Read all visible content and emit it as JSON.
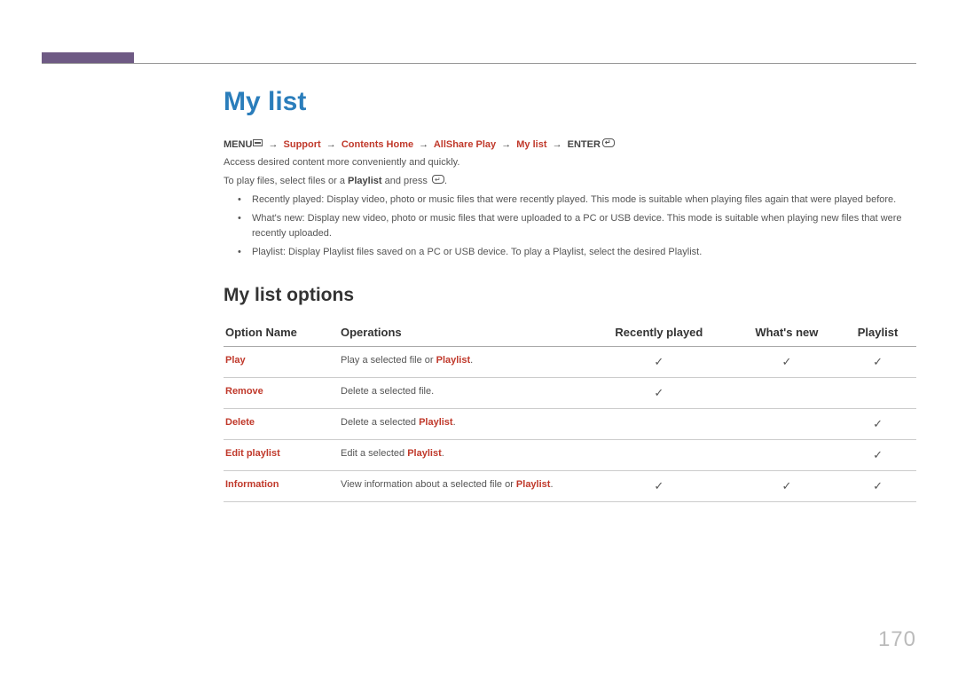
{
  "title": "My list",
  "breadcrumb": {
    "menu": "MENU",
    "parts": [
      "Support",
      "Contents Home",
      "AllShare Play",
      "My list"
    ],
    "enter": "ENTER"
  },
  "intro1": "Access desired content more conveniently and quickly.",
  "intro2_pre": "To play files, select files or a ",
  "intro2_bold": "Playlist",
  "intro2_post": " and press ",
  "bullets": [
    {
      "label": "Recently played",
      "text": ": Display video, photo or music files that were recently played. This mode is suitable when playing files again that were played before."
    },
    {
      "label": "What's new",
      "text": ": Display new video, photo or music files that were uploaded to a PC or USB device. This mode is suitable when playing new files that were recently uploaded."
    },
    {
      "label": "Playlist",
      "text_pre": ": Display ",
      "text_mid1": "Playlist",
      "text_mid2": " files saved on a PC or USB device. To play a ",
      "text_mid3": "Playlist",
      "text_mid4": ", select the desired ",
      "text_end": "Playlist",
      "period": "."
    }
  ],
  "subhead": "My list options",
  "table": {
    "headers": [
      "Option Name",
      "Operations",
      "Recently played",
      "What's new",
      "Playlist"
    ],
    "rows": [
      {
        "name": "Play",
        "op_pre": "Play a selected file or ",
        "op_bold": "Playlist",
        "op_post": ".",
        "rp": true,
        "wn": true,
        "pl": true
      },
      {
        "name": "Remove",
        "op_pre": "Delete a selected file.",
        "op_bold": "",
        "op_post": "",
        "rp": true,
        "wn": false,
        "pl": false
      },
      {
        "name": "Delete",
        "op_pre": "Delete a selected ",
        "op_bold": "Playlist",
        "op_post": ".",
        "rp": false,
        "wn": false,
        "pl": true
      },
      {
        "name": "Edit playlist",
        "op_pre": "Edit a selected ",
        "op_bold": "Playlist",
        "op_post": ".",
        "rp": false,
        "wn": false,
        "pl": true
      },
      {
        "name": "Information",
        "op_pre": "View information about a selected file or ",
        "op_bold": "Playlist",
        "op_post": ".",
        "rp": true,
        "wn": true,
        "pl": true
      }
    ]
  },
  "check": "✓",
  "page": "170"
}
